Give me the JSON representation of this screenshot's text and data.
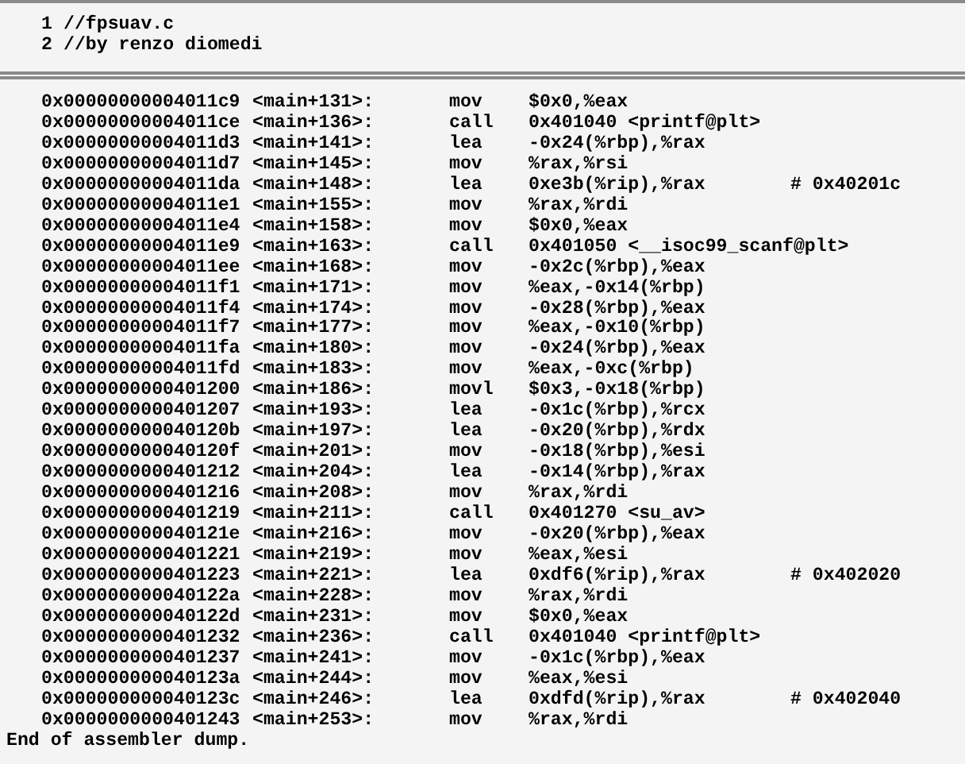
{
  "source_pane": {
    "lines": [
      {
        "number": "1",
        "text": "//fpsuav.c"
      },
      {
        "number": "2",
        "text": "//by renzo diomedi"
      }
    ]
  },
  "disassembly": {
    "rows": [
      {
        "address": "0x00000000004011c9",
        "location": "<main+131>:",
        "mnemonic": "mov",
        "operands": "$0x0,%eax"
      },
      {
        "address": "0x00000000004011ce",
        "location": "<main+136>:",
        "mnemonic": "call",
        "operands": "0x401040 <printf@plt>"
      },
      {
        "address": "0x00000000004011d3",
        "location": "<main+141>:",
        "mnemonic": "lea",
        "operands": "-0x24(%rbp),%rax"
      },
      {
        "address": "0x00000000004011d7",
        "location": "<main+145>:",
        "mnemonic": "mov",
        "operands": "%rax,%rsi"
      },
      {
        "address": "0x00000000004011da",
        "location": "<main+148>:",
        "mnemonic": "lea",
        "operands": "0xe3b(%rip),%rax",
        "comment": "# 0x40201c"
      },
      {
        "address": "0x00000000004011e1",
        "location": "<main+155>:",
        "mnemonic": "mov",
        "operands": "%rax,%rdi"
      },
      {
        "address": "0x00000000004011e4",
        "location": "<main+158>:",
        "mnemonic": "mov",
        "operands": "$0x0,%eax"
      },
      {
        "address": "0x00000000004011e9",
        "location": "<main+163>:",
        "mnemonic": "call",
        "operands": "0x401050 <__isoc99_scanf@plt>"
      },
      {
        "address": "0x00000000004011ee",
        "location": "<main+168>:",
        "mnemonic": "mov",
        "operands": "-0x2c(%rbp),%eax"
      },
      {
        "address": "0x00000000004011f1",
        "location": "<main+171>:",
        "mnemonic": "mov",
        "operands": "%eax,-0x14(%rbp)"
      },
      {
        "address": "0x00000000004011f4",
        "location": "<main+174>:",
        "mnemonic": "mov",
        "operands": "-0x28(%rbp),%eax"
      },
      {
        "address": "0x00000000004011f7",
        "location": "<main+177>:",
        "mnemonic": "mov",
        "operands": "%eax,-0x10(%rbp)"
      },
      {
        "address": "0x00000000004011fa",
        "location": "<main+180>:",
        "mnemonic": "mov",
        "operands": "-0x24(%rbp),%eax"
      },
      {
        "address": "0x00000000004011fd",
        "location": "<main+183>:",
        "mnemonic": "mov",
        "operands": "%eax,-0xc(%rbp)"
      },
      {
        "address": "0x0000000000401200",
        "location": "<main+186>:",
        "mnemonic": "movl",
        "operands": "$0x3,-0x18(%rbp)"
      },
      {
        "address": "0x0000000000401207",
        "location": "<main+193>:",
        "mnemonic": "lea",
        "operands": "-0x1c(%rbp),%rcx"
      },
      {
        "address": "0x000000000040120b",
        "location": "<main+197>:",
        "mnemonic": "lea",
        "operands": "-0x20(%rbp),%rdx"
      },
      {
        "address": "0x000000000040120f",
        "location": "<main+201>:",
        "mnemonic": "mov",
        "operands": "-0x18(%rbp),%esi"
      },
      {
        "address": "0x0000000000401212",
        "location": "<main+204>:",
        "mnemonic": "lea",
        "operands": "-0x14(%rbp),%rax"
      },
      {
        "address": "0x0000000000401216",
        "location": "<main+208>:",
        "mnemonic": "mov",
        "operands": "%rax,%rdi"
      },
      {
        "address": "0x0000000000401219",
        "location": "<main+211>:",
        "mnemonic": "call",
        "operands": "0x401270 <su_av>"
      },
      {
        "address": "0x000000000040121e",
        "location": "<main+216>:",
        "mnemonic": "mov",
        "operands": "-0x20(%rbp),%eax"
      },
      {
        "address": "0x0000000000401221",
        "location": "<main+219>:",
        "mnemonic": "mov",
        "operands": "%eax,%esi"
      },
      {
        "address": "0x0000000000401223",
        "location": "<main+221>:",
        "mnemonic": "lea",
        "operands": "0xdf6(%rip),%rax",
        "comment": "# 0x402020"
      },
      {
        "address": "0x000000000040122a",
        "location": "<main+228>:",
        "mnemonic": "mov",
        "operands": "%rax,%rdi"
      },
      {
        "address": "0x000000000040122d",
        "location": "<main+231>:",
        "mnemonic": "mov",
        "operands": "$0x0,%eax"
      },
      {
        "address": "0x0000000000401232",
        "location": "<main+236>:",
        "mnemonic": "call",
        "operands": "0x401040 <printf@plt>"
      },
      {
        "address": "0x0000000000401237",
        "location": "<main+241>:",
        "mnemonic": "mov",
        "operands": "-0x1c(%rbp),%eax"
      },
      {
        "address": "0x000000000040123a",
        "location": "<main+244>:",
        "mnemonic": "mov",
        "operands": "%eax,%esi"
      },
      {
        "address": "0x000000000040123c",
        "location": "<main+246>:",
        "mnemonic": "lea",
        "operands": "0xdfd(%rip),%rax",
        "comment": "# 0x402040"
      },
      {
        "address": "0x0000000000401243",
        "location": "<main+253>:",
        "mnemonic": "mov",
        "operands": "%rax,%rdi"
      }
    ],
    "footer": "End of assembler dump."
  }
}
